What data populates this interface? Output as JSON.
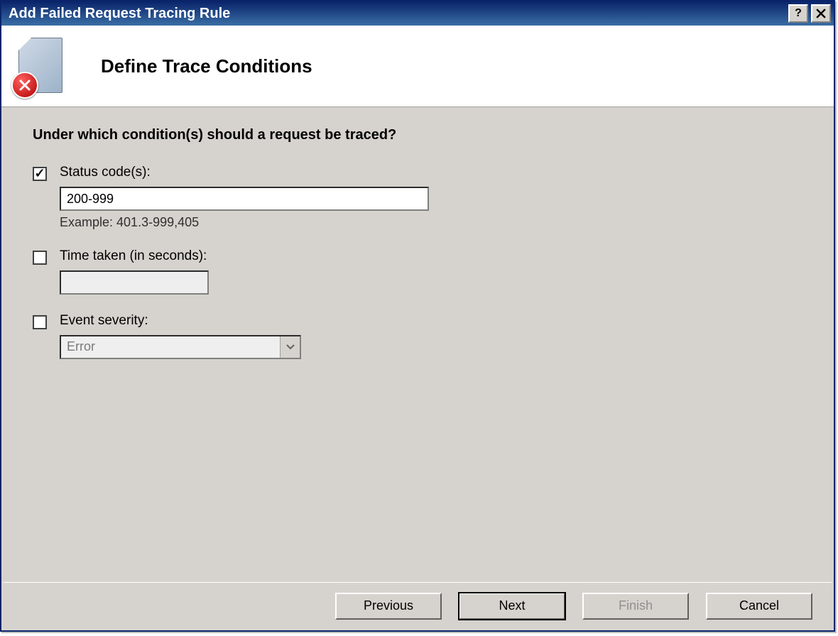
{
  "window": {
    "title": "Add Failed Request Tracing Rule"
  },
  "header": {
    "page_title": "Define Trace Conditions"
  },
  "content": {
    "question": "Under which condition(s) should a request be traced?",
    "status": {
      "label": "Status code(s):",
      "checked": true,
      "value": "200-999",
      "example": "Example: 401.3-999,405"
    },
    "time": {
      "label": "Time taken (in seconds):",
      "checked": false,
      "value": ""
    },
    "severity": {
      "label": "Event severity:",
      "checked": false,
      "selected": "Error"
    }
  },
  "footer": {
    "previous": "Previous",
    "next": "Next",
    "finish": "Finish",
    "cancel": "Cancel"
  }
}
